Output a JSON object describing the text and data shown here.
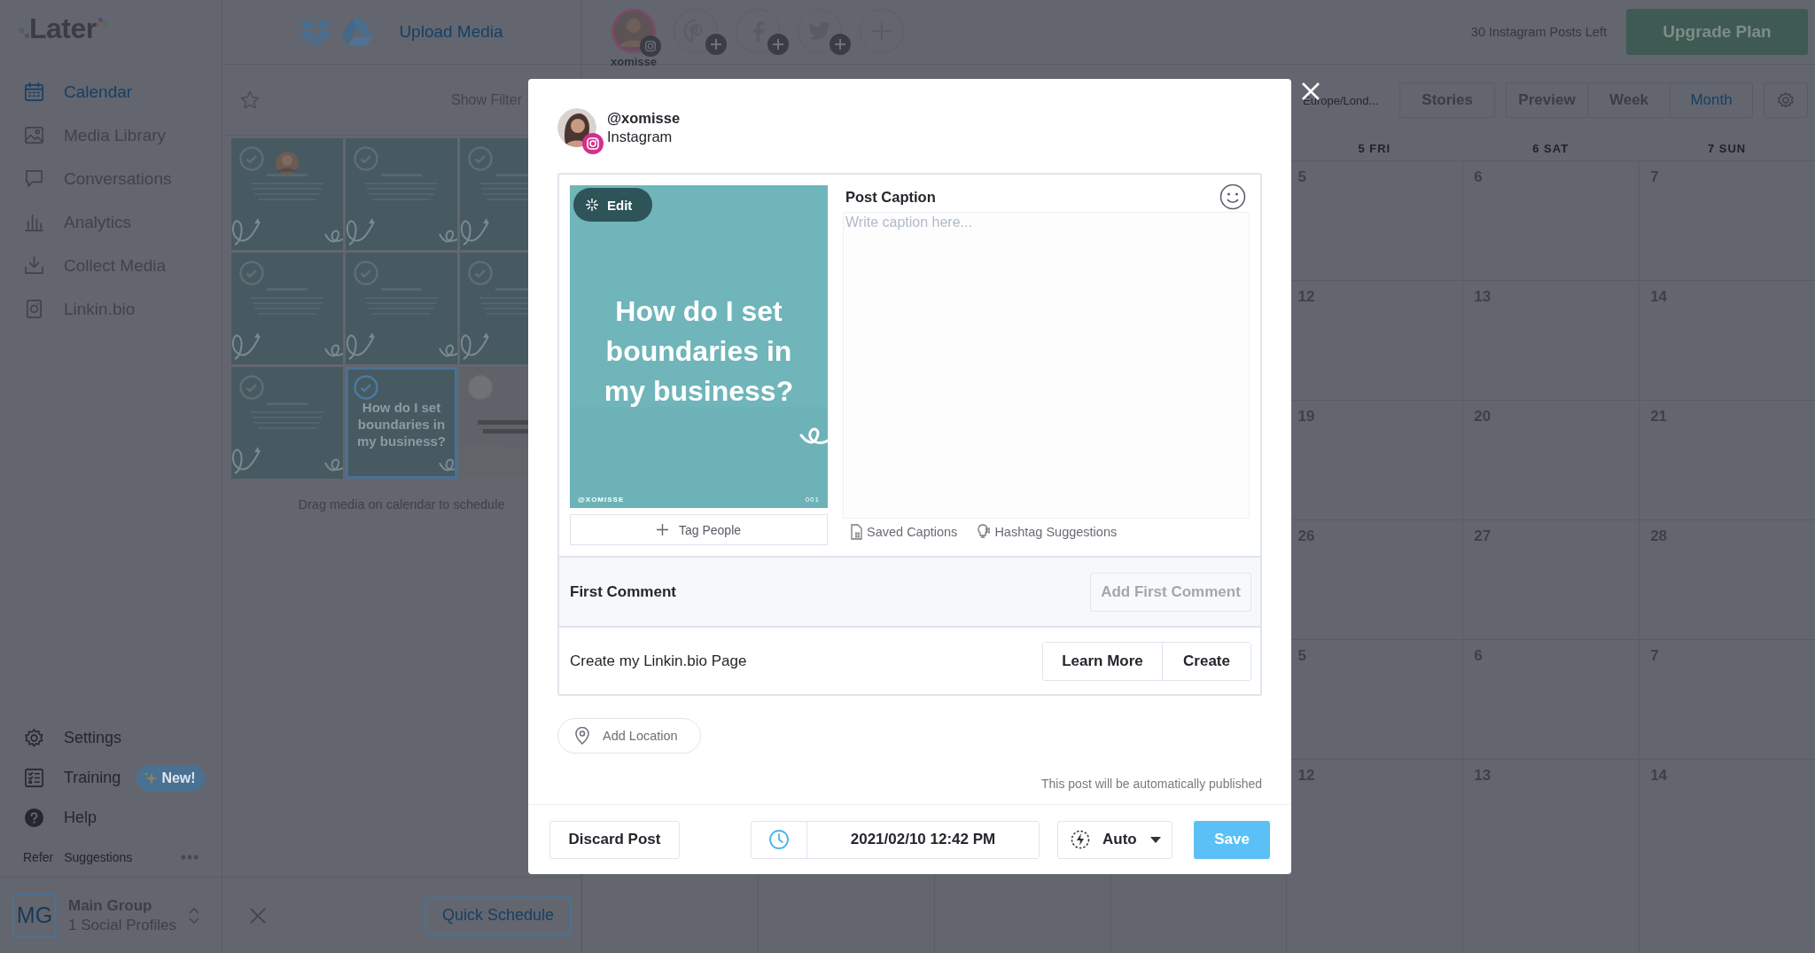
{
  "sidebar": {
    "logo": "Later",
    "nav": [
      {
        "label": "Calendar",
        "selected": true
      },
      {
        "label": "Media Library",
        "selected": false
      },
      {
        "label": "Conversations",
        "selected": false
      },
      {
        "label": "Analytics",
        "selected": false
      },
      {
        "label": "Collect Media",
        "selected": false
      },
      {
        "label": "Linkin.bio",
        "selected": false
      }
    ],
    "bottom_nav": [
      {
        "label": "Settings"
      },
      {
        "label": "Training",
        "badge": "New!"
      },
      {
        "label": "Help"
      }
    ],
    "footer_links": [
      "Refer",
      "Suggestions"
    ],
    "group": {
      "initials": "MG",
      "name": "Main Group",
      "profiles": "1 Social Profiles"
    }
  },
  "media_panel": {
    "upload_label": "Upload Media",
    "show_filters": "Show Filter",
    "thumbnails": [
      {
        "kind": "portrait",
        "selected": false
      },
      {
        "kind": "tip",
        "selected": false
      },
      {
        "kind": "tip",
        "selected": false
      },
      {
        "kind": "tip",
        "selected": false
      },
      {
        "kind": "tip",
        "selected": false
      },
      {
        "kind": "tip",
        "selected": false
      },
      {
        "kind": "tip",
        "selected": false
      },
      {
        "kind": "title",
        "selected": true,
        "text": "How do I set boundaries in my business?"
      },
      {
        "kind": "announcement",
        "selected": false
      }
    ],
    "hint": "Drag media on calendar to schedule",
    "quick_schedule": "Quick Schedule"
  },
  "header": {
    "profiles": [
      {
        "kind": "instagram",
        "name": "xomisse",
        "connected": true
      },
      {
        "kind": "pinterest",
        "connected": false
      },
      {
        "kind": "facebook",
        "connected": false
      },
      {
        "kind": "twitter",
        "connected": false
      }
    ],
    "posts_left": "30 Instagram Posts Left",
    "upgrade": "Upgrade Plan"
  },
  "calendar": {
    "timezone": "Europe/Lond...",
    "stories": "Stories",
    "views": [
      {
        "label": "Preview",
        "selected": false
      },
      {
        "label": "Week",
        "selected": false
      },
      {
        "label": "Month",
        "selected": true
      }
    ],
    "days": [
      "5 FRI",
      "6 SAT",
      "7 SUN"
    ],
    "weeks": [
      [
        "5",
        "6",
        "7"
      ],
      [
        "12",
        "13",
        "14"
      ],
      [
        "19",
        "20",
        "21"
      ],
      [
        "26",
        "27",
        "28"
      ],
      [
        "5",
        "6",
        "7"
      ],
      [
        "12",
        "13",
        "14"
      ]
    ]
  },
  "modal": {
    "account": {
      "handle": "@xomisse",
      "network": "Instagram"
    },
    "media": {
      "edit_label": "Edit",
      "headline": "How do I set boundaries in my business?",
      "watermark": "@XOMISSE",
      "number": "001"
    },
    "tag_people": "Tag People",
    "caption": {
      "label": "Post Caption",
      "placeholder": "Write caption here..."
    },
    "caption_tools": [
      "Saved Captions",
      "Hashtag Suggestions"
    ],
    "first_comment": {
      "label": "First Comment",
      "button": "Add First Comment"
    },
    "linkinbio": {
      "label": "Create my Linkin.bio Page",
      "buttons": [
        "Learn More",
        "Create"
      ]
    },
    "location": "Add Location",
    "publish_note": "This post will be automatically published",
    "footer": {
      "discard": "Discard Post",
      "datetime": "2021/02/10 12:42 PM",
      "mode": "Auto",
      "save": "Save"
    }
  }
}
